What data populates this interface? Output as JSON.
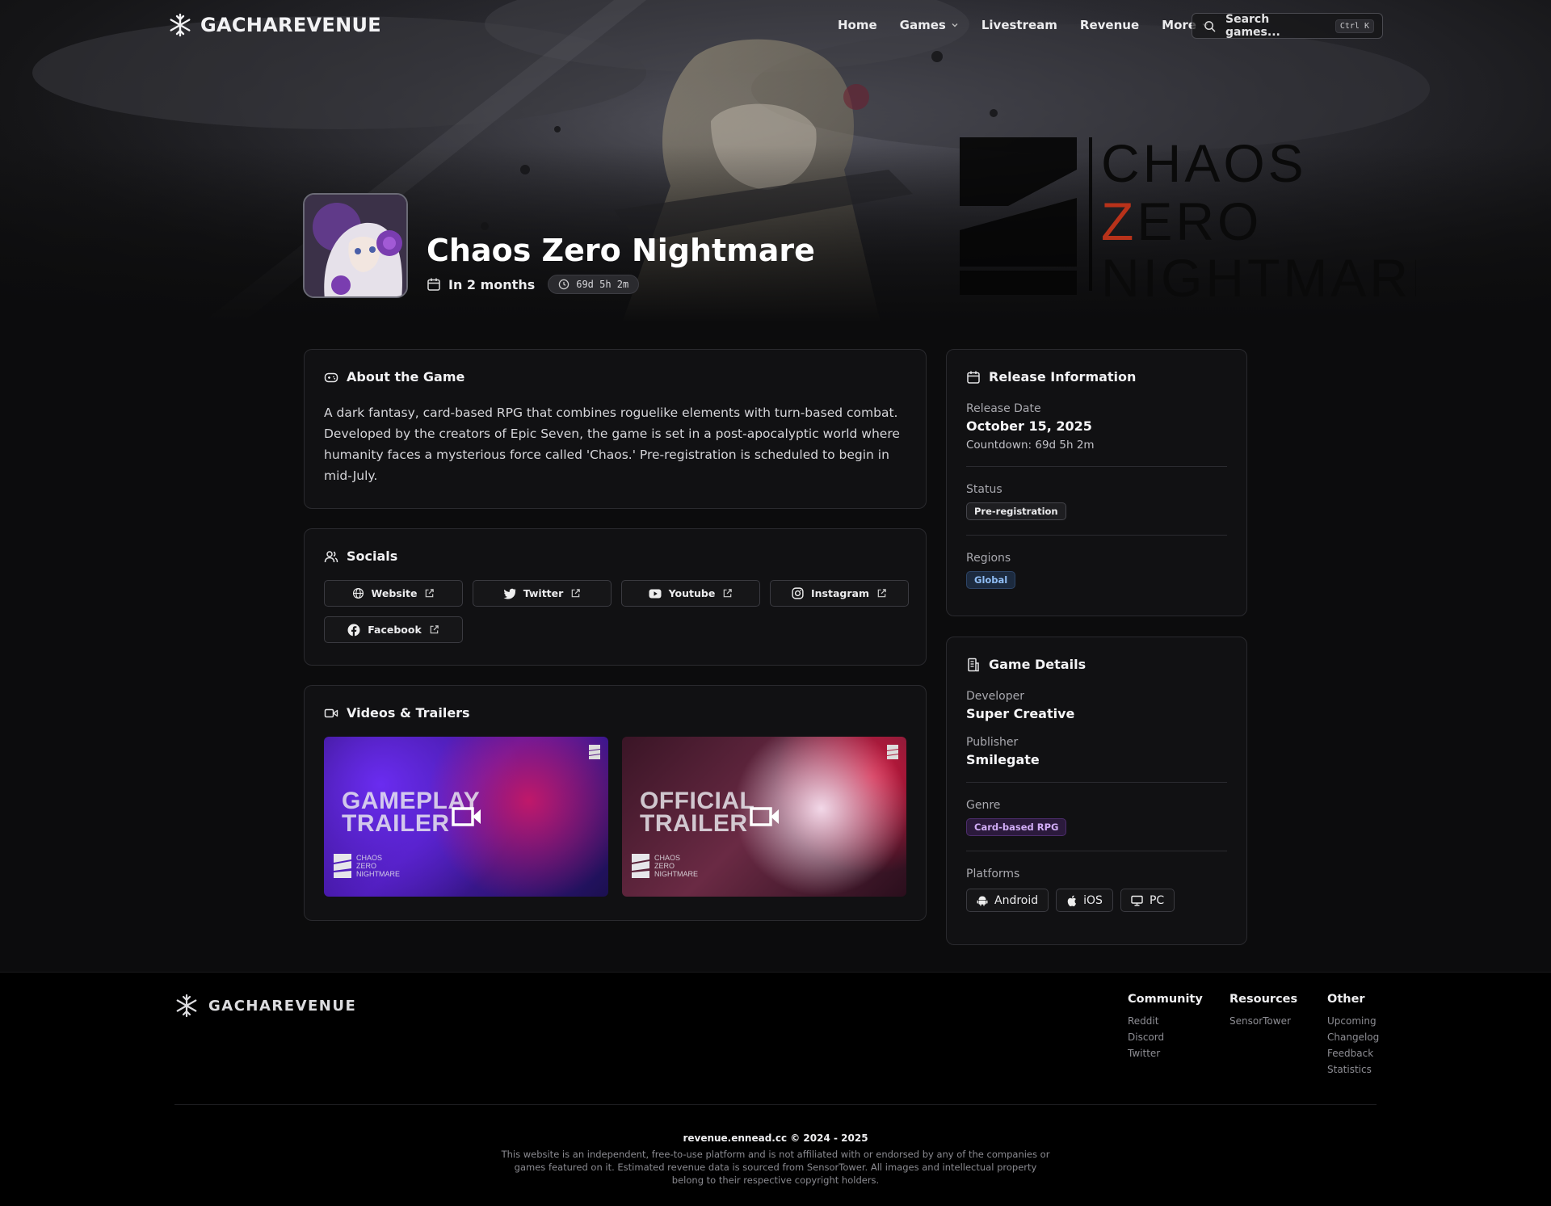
{
  "nav": {
    "brand": "GACHAREVENUE",
    "links": [
      {
        "label": "Home",
        "dropdown": false
      },
      {
        "label": "Games",
        "dropdown": true
      },
      {
        "label": "Livestream",
        "dropdown": false
      },
      {
        "label": "Revenue",
        "dropdown": false
      },
      {
        "label": "More",
        "dropdown": true
      }
    ],
    "search_placeholder": "Search games...",
    "search_shortcut": "Ctrl K"
  },
  "game": {
    "title": "Chaos Zero Nightmare",
    "release_relative": "In 2 months",
    "countdown": "69d 5h 2m",
    "logo_lines": [
      "CHAOS",
      "ZERO",
      "NIGHTMARE"
    ]
  },
  "about": {
    "heading": "About the Game",
    "text": "A dark fantasy, card-based RPG that combines roguelike elements with turn-based combat. Developed by the creators of Epic Seven, the game is set in a post-apocalyptic world where humanity faces a mysterious force called 'Chaos.' Pre-registration is scheduled to begin in mid-July."
  },
  "socials": {
    "heading": "Socials",
    "items": [
      {
        "label": "Website",
        "icon": "globe-icon"
      },
      {
        "label": "Twitter",
        "icon": "twitter-icon"
      },
      {
        "label": "Youtube",
        "icon": "youtube-icon"
      },
      {
        "label": "Instagram",
        "icon": "instagram-icon"
      },
      {
        "label": "Facebook",
        "icon": "facebook-icon"
      }
    ]
  },
  "videos": {
    "heading": "Videos & Trailers",
    "items": [
      {
        "title_line1": "GAMEPLAY",
        "title_line2": "TRAILER"
      },
      {
        "title_line1": "OFFICIAL",
        "title_line2": "TRAILER"
      }
    ],
    "mini_logo": [
      "CHAOS",
      "ZERO",
      "NIGHTMARE"
    ]
  },
  "release": {
    "heading": "Release Information",
    "date_label": "Release Date",
    "date_value": "October 15, 2025",
    "countdown_text": "Countdown: 69d 5h 2m",
    "status_label": "Status",
    "status_value": "Pre-registration",
    "regions_label": "Regions",
    "regions_value": "Global"
  },
  "details": {
    "heading": "Game Details",
    "developer_label": "Developer",
    "developer_value": "Super Creative",
    "publisher_label": "Publisher",
    "publisher_value": "Smilegate",
    "genre_label": "Genre",
    "genre_value": "Card-based RPG",
    "platforms_label": "Platforms",
    "platforms": [
      {
        "label": "Android",
        "icon": "android-icon"
      },
      {
        "label": "iOS",
        "icon": "apple-icon"
      },
      {
        "label": "PC",
        "icon": "monitor-icon"
      }
    ]
  },
  "footer": {
    "brand": "GACHAREVENUE",
    "columns": [
      {
        "title": "Community",
        "links": [
          "Reddit",
          "Discord",
          "Twitter"
        ]
      },
      {
        "title": "Resources",
        "links": [
          "SensorTower"
        ]
      },
      {
        "title": "Other",
        "links": [
          "Upcoming",
          "Changelog",
          "Feedback",
          "Statistics"
        ]
      }
    ],
    "copyright": "revenue.ennead.cc © 2024 - 2025",
    "disclaimer": "This website is an independent, free-to-use platform and is not affiliated with or endorsed by any of the companies or games featured on it. Estimated revenue data is sourced from SensorTower. All images and intellectual property belong to their respective copyright holders."
  },
  "colors": {
    "background": "#0c0c0d",
    "card": "#111113",
    "logo_accent": "#b8321a",
    "region_badge": "#90bdf4",
    "genre_badge": "#d1adf6"
  }
}
